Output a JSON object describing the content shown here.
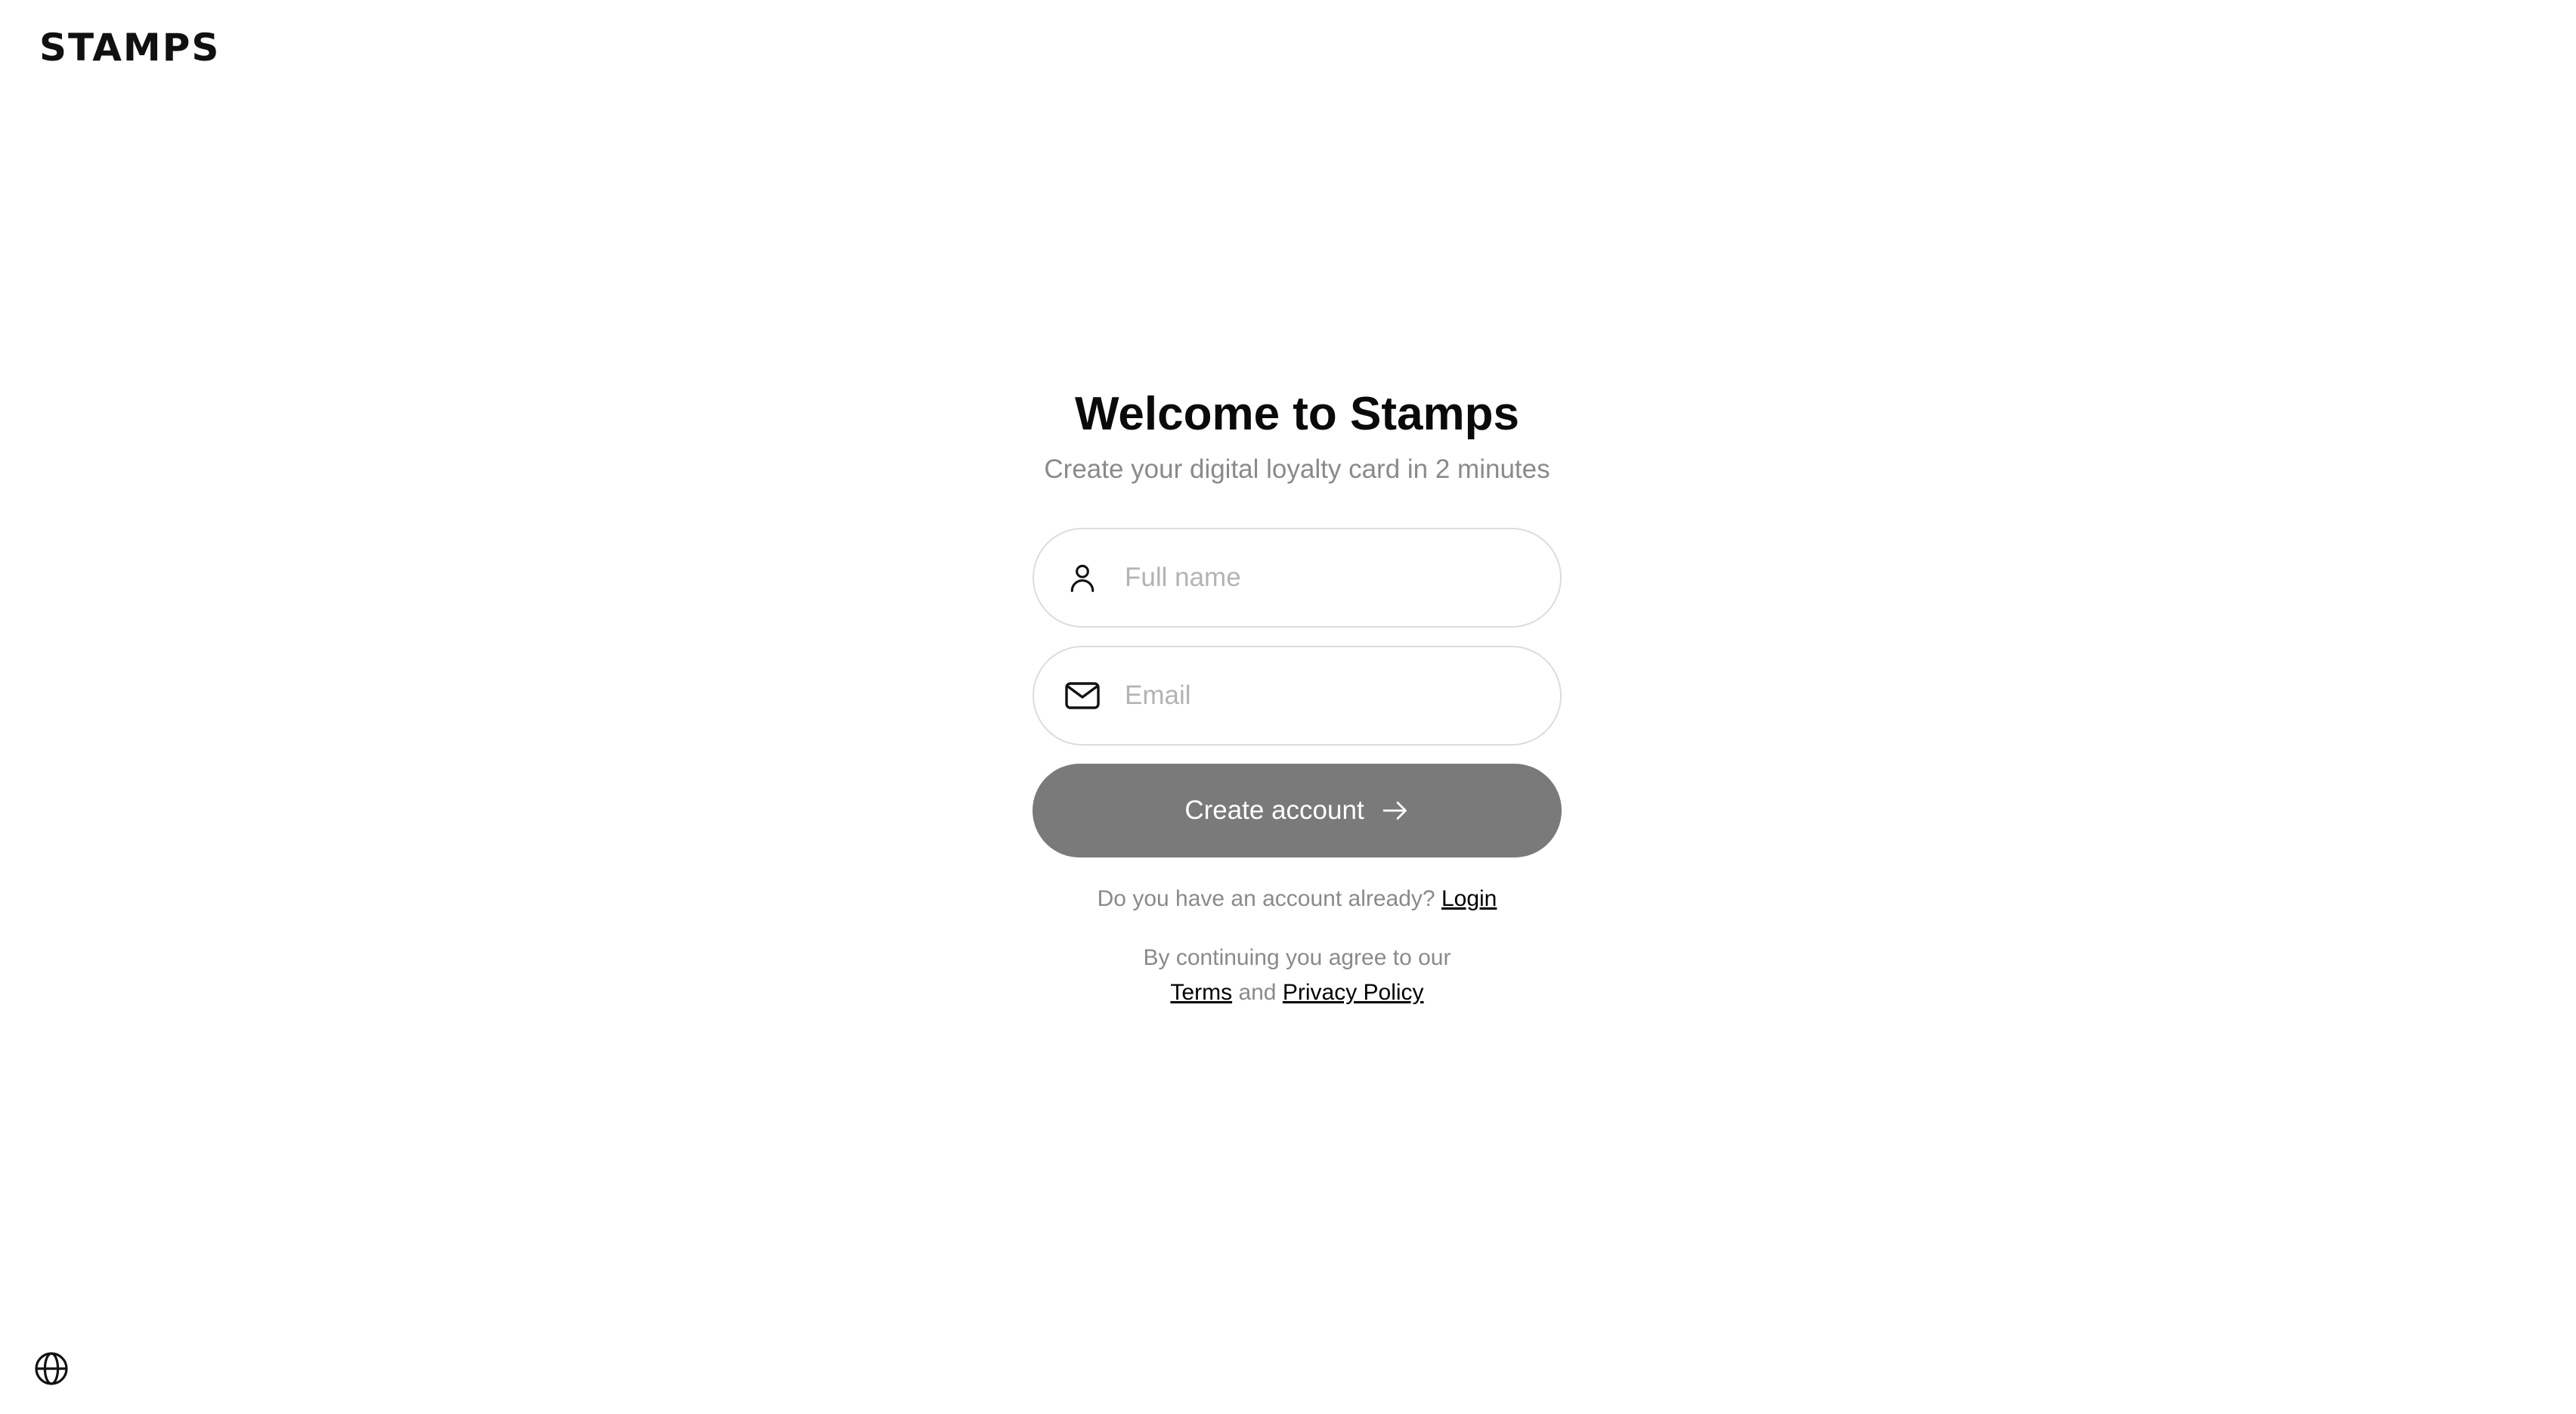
{
  "header": {
    "logo_text": "STAMPS"
  },
  "main": {
    "title": "Welcome to Stamps",
    "subtitle": "Create your digital loyalty card in 2 minutes",
    "form": {
      "full_name": {
        "placeholder": "Full name",
        "value": "",
        "icon": "user-icon"
      },
      "email": {
        "placeholder": "Email",
        "value": "",
        "icon": "mail-icon"
      },
      "submit_label": "Create account",
      "submit_icon": "arrow-right-icon",
      "submit_color": "#7a7a7a"
    },
    "login_prompt": {
      "text": "Do you have an account already?",
      "link_label": "Login"
    },
    "legal": {
      "text": "By continuing you agree to our",
      "terms_label": "Terms",
      "and_text": "and",
      "privacy_label": "Privacy Policy"
    }
  },
  "footer": {
    "language_icon": "globe-icon"
  }
}
